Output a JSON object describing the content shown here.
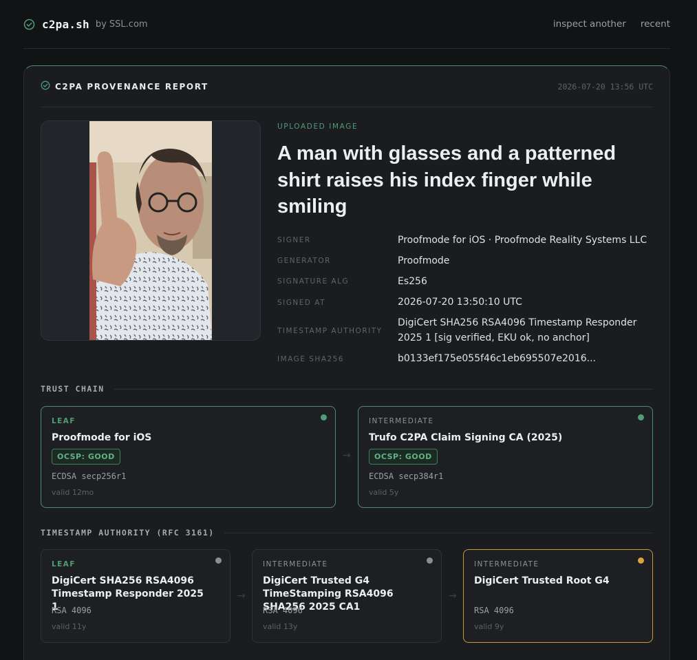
{
  "header": {
    "brand_name": "c2pa.sh",
    "brand_by": "by SSL.com",
    "nav": [
      "inspect another",
      "recent"
    ]
  },
  "report": {
    "title": "C2PA PROVENANCE REPORT",
    "timestamp": "2026-07-20 13:56 UTC",
    "upload_label": "UPLOADED IMAGE",
    "image_title": "A man with glasses and a patterned shirt raises his index finger while smiling",
    "details": [
      {
        "label": "SIGNER",
        "value": "Proofmode for iOS · Proofmode Reality Systems LLC"
      },
      {
        "label": "GENERATOR",
        "value": "Proofmode"
      },
      {
        "label": "SIGNATURE ALG",
        "value": "Es256"
      },
      {
        "label": "SIGNED AT",
        "value": "2026-07-20 13:50:10 UTC"
      },
      {
        "label": "TIMESTAMP AUTHORITY",
        "value": "DigiCert SHA256 RSA4096 Timestamp Responder 2025 1 [sig verified, EKU ok, no anchor]"
      },
      {
        "label": "IMAGE SHA256",
        "value": "b0133ef175e055f46c1eb695507e2016..."
      }
    ]
  },
  "trust_chain": {
    "title": "TRUST CHAIN",
    "certs": [
      {
        "role": "LEAF",
        "name": "Proofmode for iOS",
        "badge": "OCSP: GOOD",
        "alg": "ECDSA secp256r1",
        "valid": "valid 12mo"
      },
      {
        "role": "INTERMEDIATE",
        "name": "Trufo C2PA Claim Signing CA (2025)",
        "badge": "OCSP: GOOD",
        "alg": "ECDSA secp384r1",
        "valid": "valid 5y"
      }
    ]
  },
  "timestamp_authority": {
    "title": "TIMESTAMP AUTHORITY (RFC 3161)",
    "certs": [
      {
        "role": "LEAF",
        "name": "DigiCert SHA256 RSA4096 Timestamp Responder 2025 1",
        "alg": "RSA 4096",
        "valid": "valid 11y"
      },
      {
        "role": "INTERMEDIATE",
        "name": "DigiCert Trusted G4 TimeStamping RSA4096 SHA256 2025 CA1",
        "alg": "RSA 4096",
        "valid": "valid 13y"
      },
      {
        "role": "INTERMEDIATE",
        "name": "DigiCert Trusted Root G4",
        "alg": "RSA 4096",
        "valid": "valid 9y"
      }
    ]
  },
  "colors": {
    "accent_green": "#4f9d75",
    "status_grey": "#8a8e94",
    "status_amber": "#d9a441"
  },
  "icons": [
    "check-circle-icon",
    "arrow-right-icon",
    "status-dot-icon"
  ]
}
